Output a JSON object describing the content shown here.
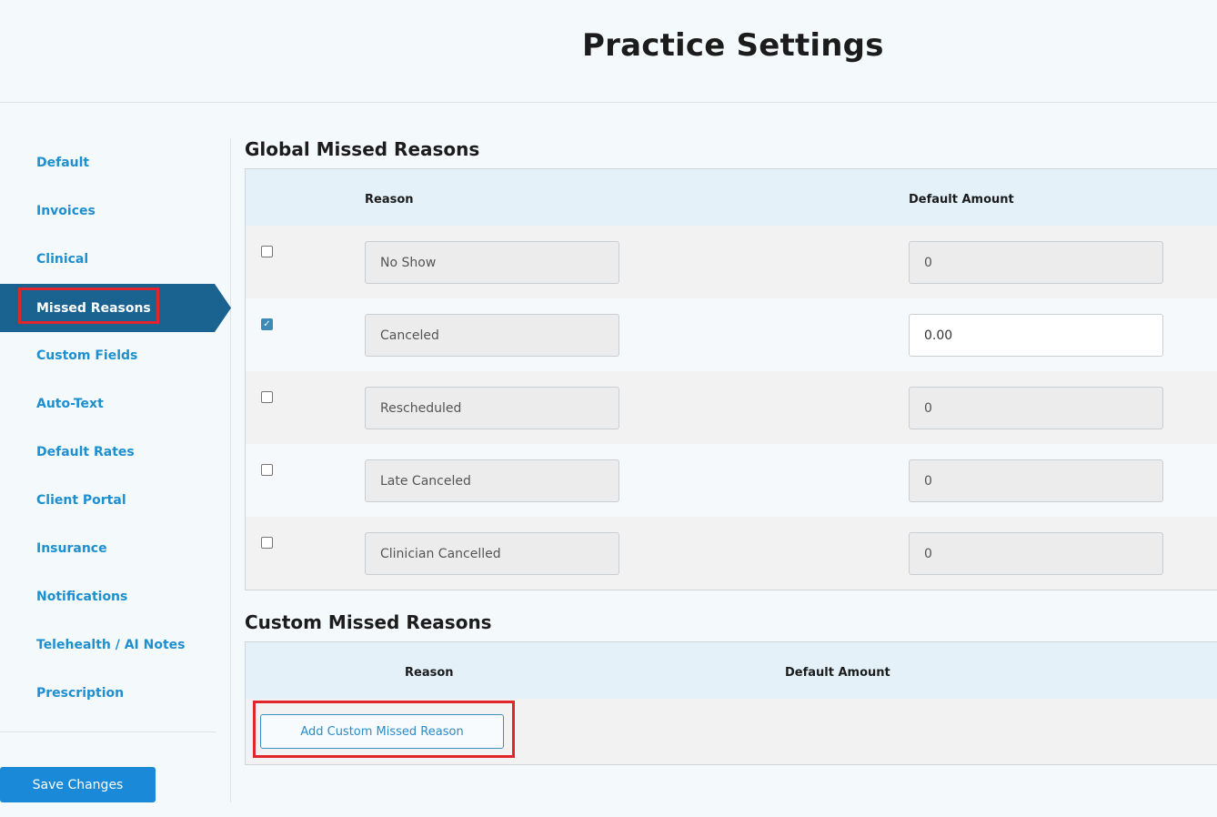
{
  "header": {
    "title": "Practice Settings"
  },
  "sidebar": {
    "items": [
      {
        "label": "Default"
      },
      {
        "label": "Invoices"
      },
      {
        "label": "Clinical"
      },
      {
        "label": "Missed Reasons",
        "active": true
      },
      {
        "label": "Custom Fields"
      },
      {
        "label": "Auto-Text"
      },
      {
        "label": "Default Rates"
      },
      {
        "label": "Client Portal"
      },
      {
        "label": "Insurance"
      },
      {
        "label": "Notifications"
      },
      {
        "label": "Telehealth / AI Notes"
      },
      {
        "label": "Prescription"
      }
    ],
    "save_label": "Save Changes"
  },
  "global": {
    "title": "Global Missed Reasons",
    "col_reason": "Reason",
    "col_amount": "Default Amount",
    "rows": [
      {
        "reason": "No Show",
        "amount": "0",
        "checked": false
      },
      {
        "reason": "Canceled",
        "amount": "0.00",
        "checked": true
      },
      {
        "reason": "Rescheduled",
        "amount": "0",
        "checked": false
      },
      {
        "reason": "Late Canceled",
        "amount": "0",
        "checked": false
      },
      {
        "reason": "Clinician Cancelled",
        "amount": "0",
        "checked": false
      }
    ]
  },
  "custom": {
    "title": "Custom Missed Reasons",
    "col_reason": "Reason",
    "col_amount": "Default Amount",
    "add_label": "Add Custom Missed Reason"
  },
  "colors": {
    "accent": "#1a6391",
    "link": "#1e8fcf",
    "button": "#1a8ad8",
    "highlight": "#e0252b"
  }
}
